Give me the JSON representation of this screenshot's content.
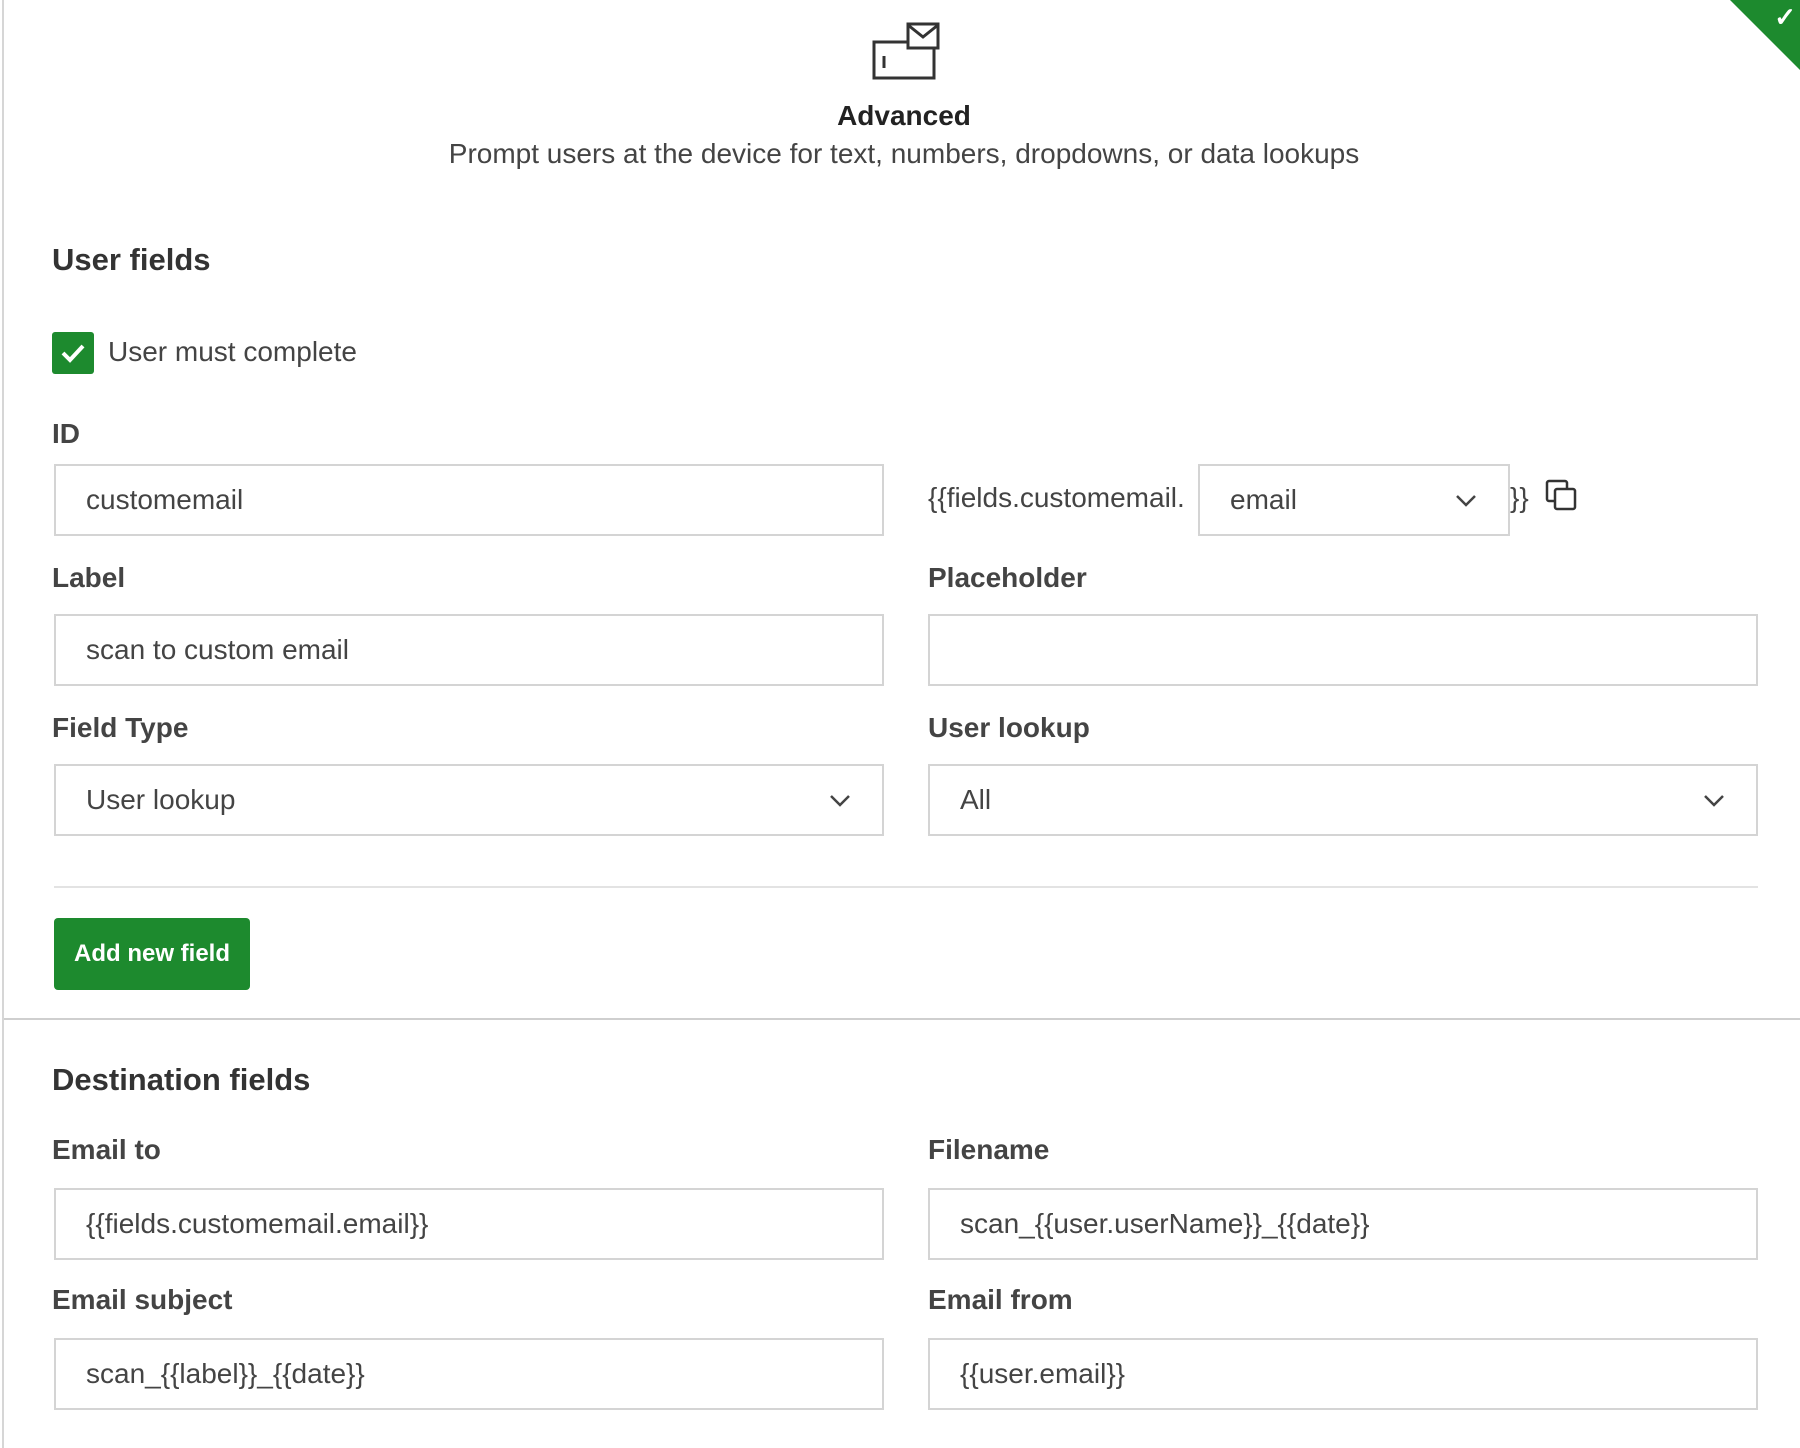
{
  "header": {
    "icon": "device-prompt-icon",
    "title": "Advanced",
    "description": "Prompt users at the device for text, numbers, dropdowns, or data lookups"
  },
  "status": {
    "icon": "check-icon",
    "color": "#1d8a2e"
  },
  "user_fields": {
    "section_title": "User fields",
    "must_complete": {
      "label": "User must complete",
      "checked": true
    },
    "id": {
      "label": "ID",
      "value": "customemail"
    },
    "token": {
      "prefix": "{{fields.customemail.",
      "property": "email",
      "suffix": "}}",
      "copy_icon": "copy-icon"
    },
    "label_field": {
      "label": "Label",
      "value": "scan to custom email"
    },
    "placeholder_field": {
      "label": "Placeholder",
      "value": ""
    },
    "field_type": {
      "label": "Field Type",
      "value": "User lookup"
    },
    "user_lookup": {
      "label": "User lookup",
      "value": "All"
    },
    "add_button": "Add new field"
  },
  "destination_fields": {
    "section_title": "Destination fields",
    "email_to": {
      "label": "Email to",
      "value": "{{fields.customemail.email}}"
    },
    "filename": {
      "label": "Filename",
      "value": "scan_{{user.userName}}_{{date}}"
    },
    "email_subject": {
      "label": "Email subject",
      "value": "scan_{{label}}_{{date}}"
    },
    "email_from": {
      "label": "Email from",
      "value": "{{user.email}}"
    }
  },
  "colors": {
    "accent": "#1d8a2e",
    "border": "#d4d4d4",
    "text": "#444444"
  }
}
